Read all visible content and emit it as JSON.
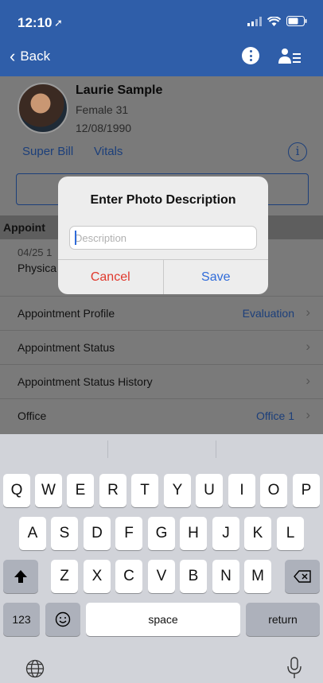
{
  "status_bar": {
    "time": "12:10"
  },
  "nav": {
    "back_label": "Back"
  },
  "patient": {
    "name": "Laurie Sample",
    "gender_age": "Female 31",
    "dob": "12/08/1990",
    "links": [
      "Super Bill",
      "Vitals"
    ]
  },
  "appointment": {
    "section_title": "Appoint",
    "date": "04/25 1",
    "type": "Physica"
  },
  "rows": [
    {
      "label": "Appointment Profile",
      "value": "Evaluation"
    },
    {
      "label": "Appointment Status",
      "value": ""
    },
    {
      "label": "Appointment Status History",
      "value": ""
    },
    {
      "label": "Office",
      "value": "Office 1"
    }
  ],
  "modal": {
    "title": "Enter Photo Description",
    "placeholder": "Description",
    "cancel": "Cancel",
    "save": "Save"
  },
  "keyboard": {
    "row1": [
      "Q",
      "W",
      "E",
      "R",
      "T",
      "Y",
      "U",
      "I",
      "O",
      "P"
    ],
    "row2": [
      "A",
      "S",
      "D",
      "F",
      "G",
      "H",
      "J",
      "K",
      "L"
    ],
    "row3": [
      "Z",
      "X",
      "C",
      "V",
      "B",
      "N",
      "M"
    ],
    "numbers": "123",
    "space": "space",
    "return": "return"
  }
}
